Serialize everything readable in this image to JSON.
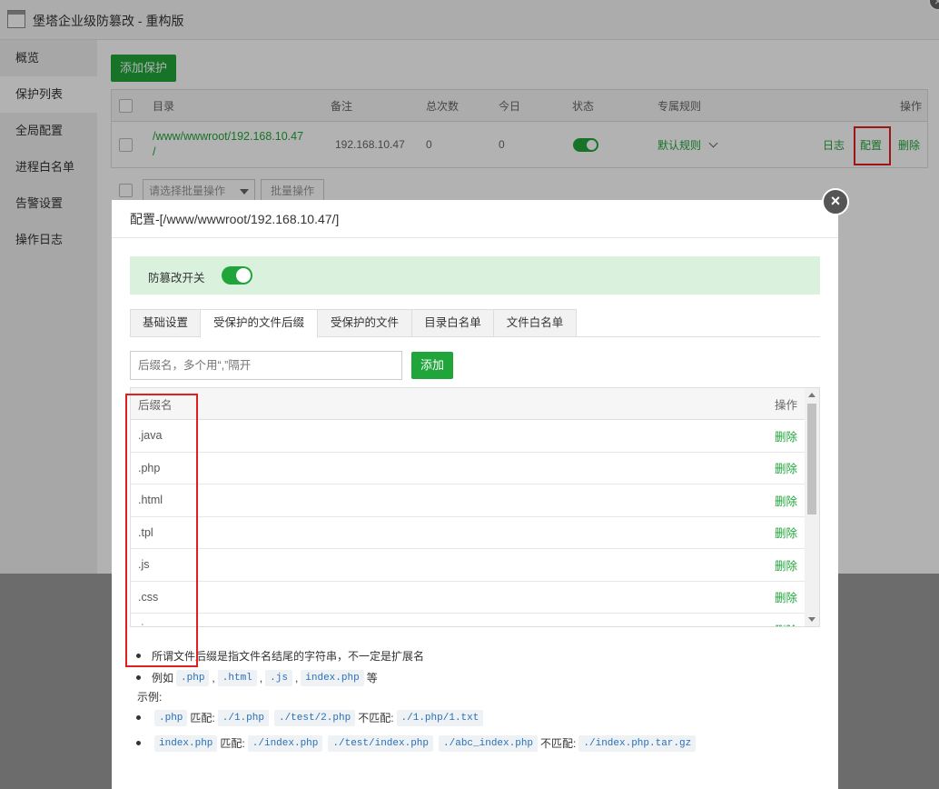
{
  "window": {
    "title": "堡塔企业级防篡改 - 重构版",
    "close_glyph": "×"
  },
  "sidebar": {
    "items": [
      {
        "label": "概览"
      },
      {
        "label": "保护列表"
      },
      {
        "label": "全局配置"
      },
      {
        "label": "进程白名单"
      },
      {
        "label": "告警设置"
      },
      {
        "label": "操作日志"
      }
    ],
    "active_index": 1
  },
  "main": {
    "add_button": "添加保护",
    "table": {
      "headers": {
        "dir": "目录",
        "note": "备注",
        "total": "总次数",
        "today": "今日",
        "status": "状态",
        "rule": "专属规则",
        "ops": "操作"
      },
      "rows": [
        {
          "dir_line1": "/www/wwwroot/192.168.10.47",
          "dir_line2": "/",
          "note": "192.168.10.47",
          "total": "0",
          "today": "0",
          "status_on": true,
          "rule": "默认规则",
          "op_log": "日志",
          "op_config": "配置",
          "op_delete": "删除"
        }
      ]
    },
    "batch": {
      "select_placeholder": "请选择批量操作",
      "button": "批量操作"
    }
  },
  "modal": {
    "title": "配置-[/www/wwwroot/192.168.10.47/]",
    "close_glyph": "×",
    "switch_label": "防篡改开关",
    "switch_on": true,
    "tabs": [
      {
        "label": "基础设置"
      },
      {
        "label": "受保护的文件后缀"
      },
      {
        "label": "受保护的文件"
      },
      {
        "label": "目录白名单"
      },
      {
        "label": "文件白名单"
      }
    ],
    "active_tab": 1,
    "input_placeholder": "后缀名，多个用“,”隔开",
    "add_button": "添加",
    "list": {
      "header_name": "后缀名",
      "header_op": "操作",
      "rows": [
        {
          "name": ".java",
          "op": "删除"
        },
        {
          "name": ".php",
          "op": "删除"
        },
        {
          "name": ".html",
          "op": "删除"
        },
        {
          "name": ".tpl",
          "op": "删除"
        },
        {
          "name": ".js",
          "op": "删除"
        },
        {
          "name": ".css",
          "op": "删除"
        },
        {
          "name": ".j",
          "op": "删除"
        }
      ]
    },
    "notes": {
      "line1": "所谓文件后缀是指文件名结尾的字符串，不一定是扩展名",
      "line2_prefix": "例如",
      "line2_codes": [
        ".php",
        ".html",
        ".js",
        "index.php"
      ],
      "line2_sep": ",",
      "line2_suffix": "等",
      "examples_label": "示例:",
      "ex1_code": ".php",
      "ex1_match": "匹配:",
      "ex1_match_codes": [
        "./1.php",
        "./test/2.php"
      ],
      "ex1_nomatch": "不匹配:",
      "ex1_nomatch_code": "./1.php/1.txt",
      "ex2_code": "index.php",
      "ex2_match": "匹配:",
      "ex2_match_codes": [
        "./index.php",
        "./test/index.php",
        "./abc_index.php"
      ],
      "ex2_nomatch": "不匹配:",
      "ex2_nomatch_code": "./index.php.tar.gz"
    }
  },
  "colors": {
    "accent": "#20a53a",
    "highlight_box": "#e02020",
    "switch_bg": "#d9f1dd"
  }
}
